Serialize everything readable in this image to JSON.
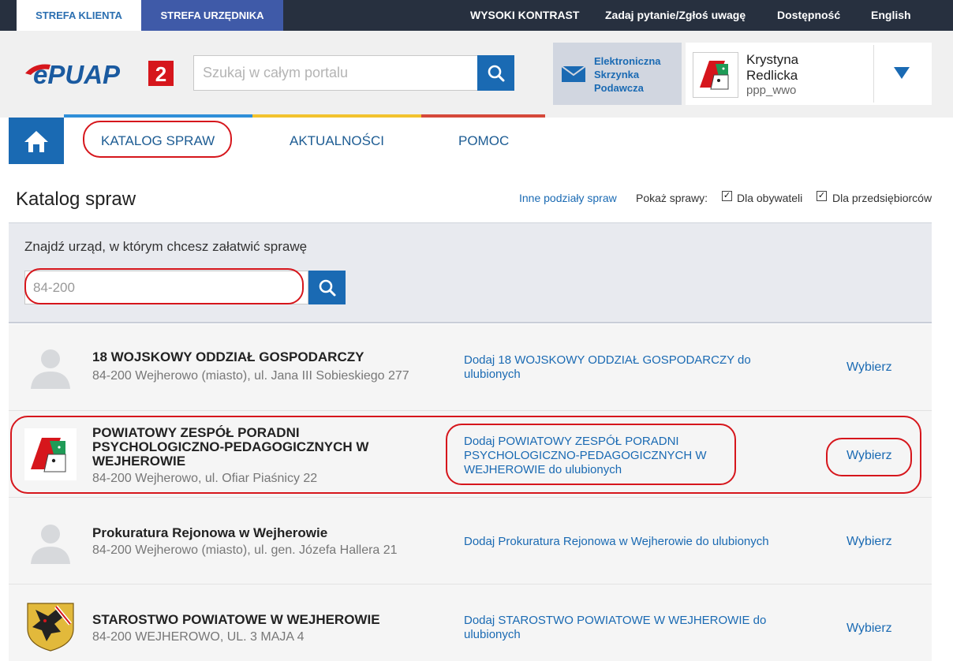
{
  "topbar": {
    "tab_client": "STREFA KLIENTA",
    "tab_official": "STREFA URZĘDNIKA",
    "links": [
      "WYSOKI KONTRAST",
      "Zadaj pytanie/Zgłoś uwagę",
      "Dostępność",
      "English"
    ]
  },
  "header": {
    "logo_text": "ePUAP",
    "logo_version": "2",
    "search_placeholder": "Szukaj w całym portalu",
    "esp_label": [
      "Elektroniczna",
      "Skrzynka",
      "Podawcza"
    ],
    "user": {
      "first_name": "Krystyna",
      "last_name": "Redlicka",
      "login": "ppp_wwo"
    }
  },
  "nav": {
    "items": [
      "KATALOG SPRAW",
      "AKTUALNOŚCI",
      "POMOC"
    ],
    "strip_colors": [
      "#2f8fd8",
      "#f2c22e",
      "#d5483a"
    ]
  },
  "catalog": {
    "title": "Katalog spraw",
    "other_link": "Inne podziały spraw",
    "show_label": "Pokaż sprawy:",
    "filters": [
      {
        "label": "Dla obywateli",
        "checked": true
      },
      {
        "label": "Dla przedsiębiorców",
        "checked": true
      }
    ]
  },
  "office_search": {
    "label": "Znajdź urząd, w którym chcesz załatwić sprawę",
    "value": "84-200"
  },
  "results": [
    {
      "name_lines": [
        "18 WOJSKOWY ODDZIAŁ GOSPODARCZY"
      ],
      "address": "84-200 Wejherowo (miasto), ul. Jana III Sobieskiego 277",
      "fav_lines": [
        "Dodaj 18 WOJSKOWY ODDZIAŁ GOSPODARCZY do",
        "ulubionych"
      ],
      "select": "Wybierz",
      "icon": "placeholder-person-icon"
    },
    {
      "name_lines": [
        "POWIATOWY ZESPÓŁ PORADNI",
        "PSYCHOLOGICZNO-PEDAGOGICZNYCH W",
        "WEJHEROWIE"
      ],
      "address": "84-200 Wejherowo, ul. Ofiar Piaśnicy 22",
      "fav_lines": [
        "Dodaj POWIATOWY ZESPÓŁ PORADNI",
        "PSYCHOLOGICZNO-PEDAGOGICZNYCH W",
        "WEJHEROWIE do ulubionych"
      ],
      "select": "Wybierz",
      "icon": "ppp-logo-icon"
    },
    {
      "name_lines": [
        "Prokuratura Rejonowa w Wejherowie"
      ],
      "address": "84-200 Wejherowo (miasto), ul. gen. Józefa Hallera 21",
      "fav_lines": [
        "Dodaj Prokuratura Rejonowa w Wejherowie do ulubionych"
      ],
      "select": "Wybierz",
      "icon": "placeholder-person-icon"
    },
    {
      "name_lines": [
        "STAROSTWO POWIATOWE W WEJHEROWIE"
      ],
      "address": "84-200 WEJHEROWO, UL. 3 MAJA 4",
      "fav_lines": [
        "Dodaj STAROSTWO POWIATOWE W WEJHEROWIE do",
        "ulubionych"
      ],
      "select": "Wybierz",
      "icon": "coat-of-arms-icon"
    }
  ],
  "colors": {
    "brand_blue": "#1a6ab3",
    "topbar_bg": "#27303f",
    "highlight_red": "#d6161c"
  }
}
